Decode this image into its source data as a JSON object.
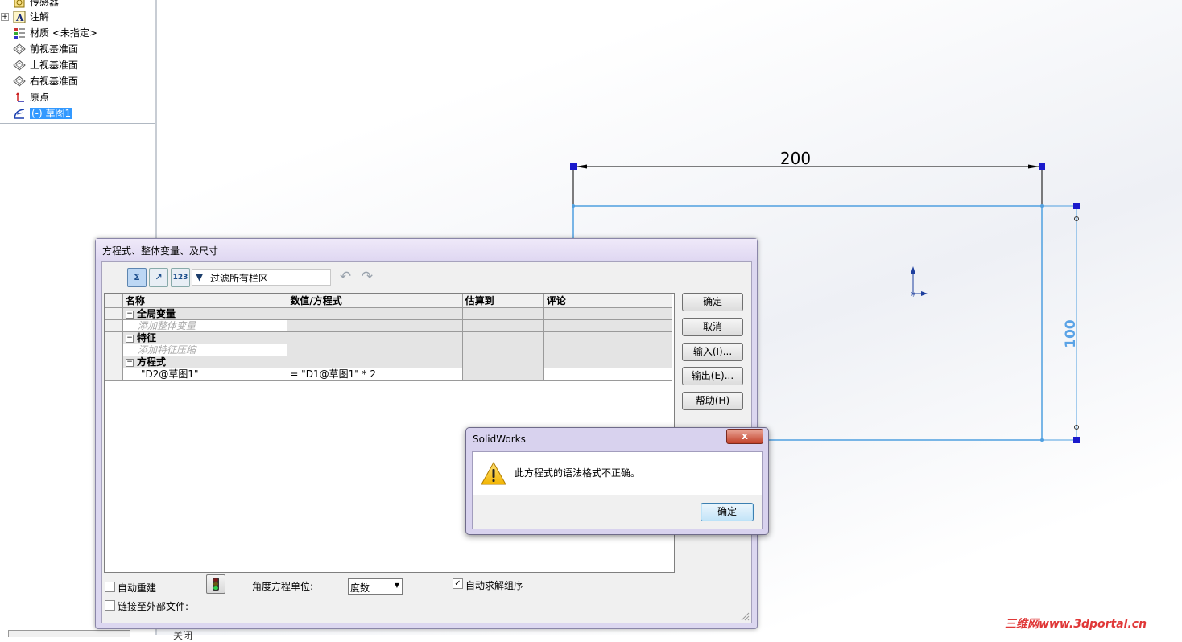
{
  "feature_tree": {
    "items": [
      {
        "label": "传感器",
        "icon": "sensor-icon"
      },
      {
        "label": "注解",
        "icon": "annotation-icon",
        "expandable": true
      },
      {
        "label": "材质 <未指定>",
        "icon": "material-icon"
      },
      {
        "label": "前视基准面",
        "icon": "plane-icon"
      },
      {
        "label": "上视基准面",
        "icon": "plane-icon"
      },
      {
        "label": "右视基准面",
        "icon": "plane-icon"
      },
      {
        "label": "原点",
        "icon": "origin-icon"
      },
      {
        "label": "(-) 草图1",
        "icon": "sketch-icon",
        "selected": true
      }
    ],
    "expander": "+"
  },
  "sketch": {
    "horizontal_dimension": "200",
    "vertical_dimension": "100",
    "line_color": "#4f9fe0",
    "dimension_color": "#5aa3e6"
  },
  "equations_dialog": {
    "title": "方程式、整体变量、及尺寸",
    "toolbar": {
      "filter_text": "过滤所有栏区",
      "view_equations_glyph": "Σ",
      "view_sketch_glyph": "↗",
      "view_ordered_glyph": "123"
    },
    "columns": [
      "名称",
      "数值/方程式",
      "估算到",
      "评论"
    ],
    "collapse_glyph": "−",
    "sections": [
      {
        "title": "全局变量",
        "placeholder": "添加整体变量"
      },
      {
        "title": "特征",
        "placeholder": "添加特征压缩"
      },
      {
        "title": "方程式",
        "rows": [
          {
            "name": "\"D2@草图1\"",
            "value": "= \"D1@草图1\" * 2",
            "evaluates": "",
            "comment": ""
          }
        ]
      }
    ],
    "buttons": {
      "ok": "确定",
      "cancel": "取消",
      "import": "输入(I)...",
      "export": "输出(E)...",
      "help": "帮助(H)"
    },
    "options": {
      "auto_rebuild_label": "自动重建",
      "auto_rebuild_checked": false,
      "angle_unit_label": "角度方程单位:",
      "angle_unit_value": "度数",
      "auto_solve_label": "自动求解组序",
      "auto_solve_checked": true,
      "link_external_label": "链接至外部文件:",
      "link_external_checked": false
    }
  },
  "error_dialog": {
    "title": "SolidWorks",
    "message": "此方程式的语法格式不正确。",
    "ok_label": "确定",
    "close_glyph": "x"
  },
  "bottom_partial_text": "关闭",
  "watermark": "三维网www.3dportal.cn"
}
